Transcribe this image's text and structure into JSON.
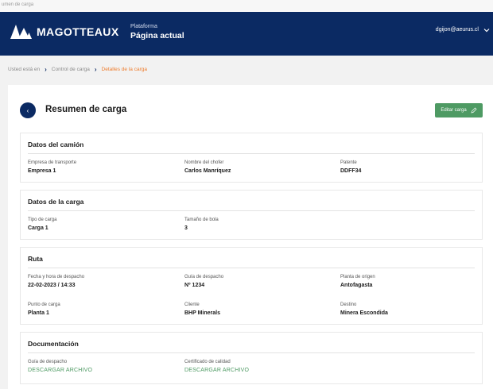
{
  "window": {
    "title": "umen de carga"
  },
  "header": {
    "brand": "MAGOTTEAUX",
    "platform_label": "Plataforma",
    "platform_page": "Página actual",
    "user_email": "dgijon@aeurus.cl",
    "colors": {
      "bar": "#0b2a63",
      "text": "#ffffff"
    }
  },
  "breadcrumb": {
    "items": [
      "Usted está en",
      "Control de carga",
      "Detalles de la carga"
    ],
    "current_color": "#ee7d2e"
  },
  "page": {
    "title": "Resumen de carga",
    "edit_label": "Editar carga",
    "accent": "#4e9a63"
  },
  "sections": {
    "camion": {
      "title": "Datos del camión",
      "fields": [
        {
          "label": "Empresa de transporte",
          "value": "Empresa 1"
        },
        {
          "label": "Nombre del chofer",
          "value": "Carlos Manríquez"
        },
        {
          "label": "Patente",
          "value": "DDFF34"
        }
      ]
    },
    "carga": {
      "title": "Datos de la carga",
      "fields": [
        {
          "label": "Tipo de carga",
          "value": "Carga 1"
        },
        {
          "label": "Tamaño de bola",
          "value": "3"
        }
      ]
    },
    "ruta": {
      "title": "Ruta",
      "fields": [
        {
          "label": "Fecha y hora de despacho",
          "value": "22-02-2023 / 14:33"
        },
        {
          "label": "Guía de despacho",
          "value": "Nº 1234"
        },
        {
          "label": "Planta de origen",
          "value": "Antofagasta"
        },
        {
          "label": "Punto de carga",
          "value": "Planta 1"
        },
        {
          "label": "Cliente",
          "value": "BHP Minerals"
        },
        {
          "label": "Destino",
          "value": "Minera Escondida"
        }
      ]
    },
    "documentacion": {
      "title": "Documentación",
      "fields": [
        {
          "label": "Guía de despacho",
          "link": "DESCARGAR ARCHIVO"
        },
        {
          "label": "Certificado de calidad",
          "link": "DESCARGAR ARCHIVO"
        }
      ]
    }
  }
}
